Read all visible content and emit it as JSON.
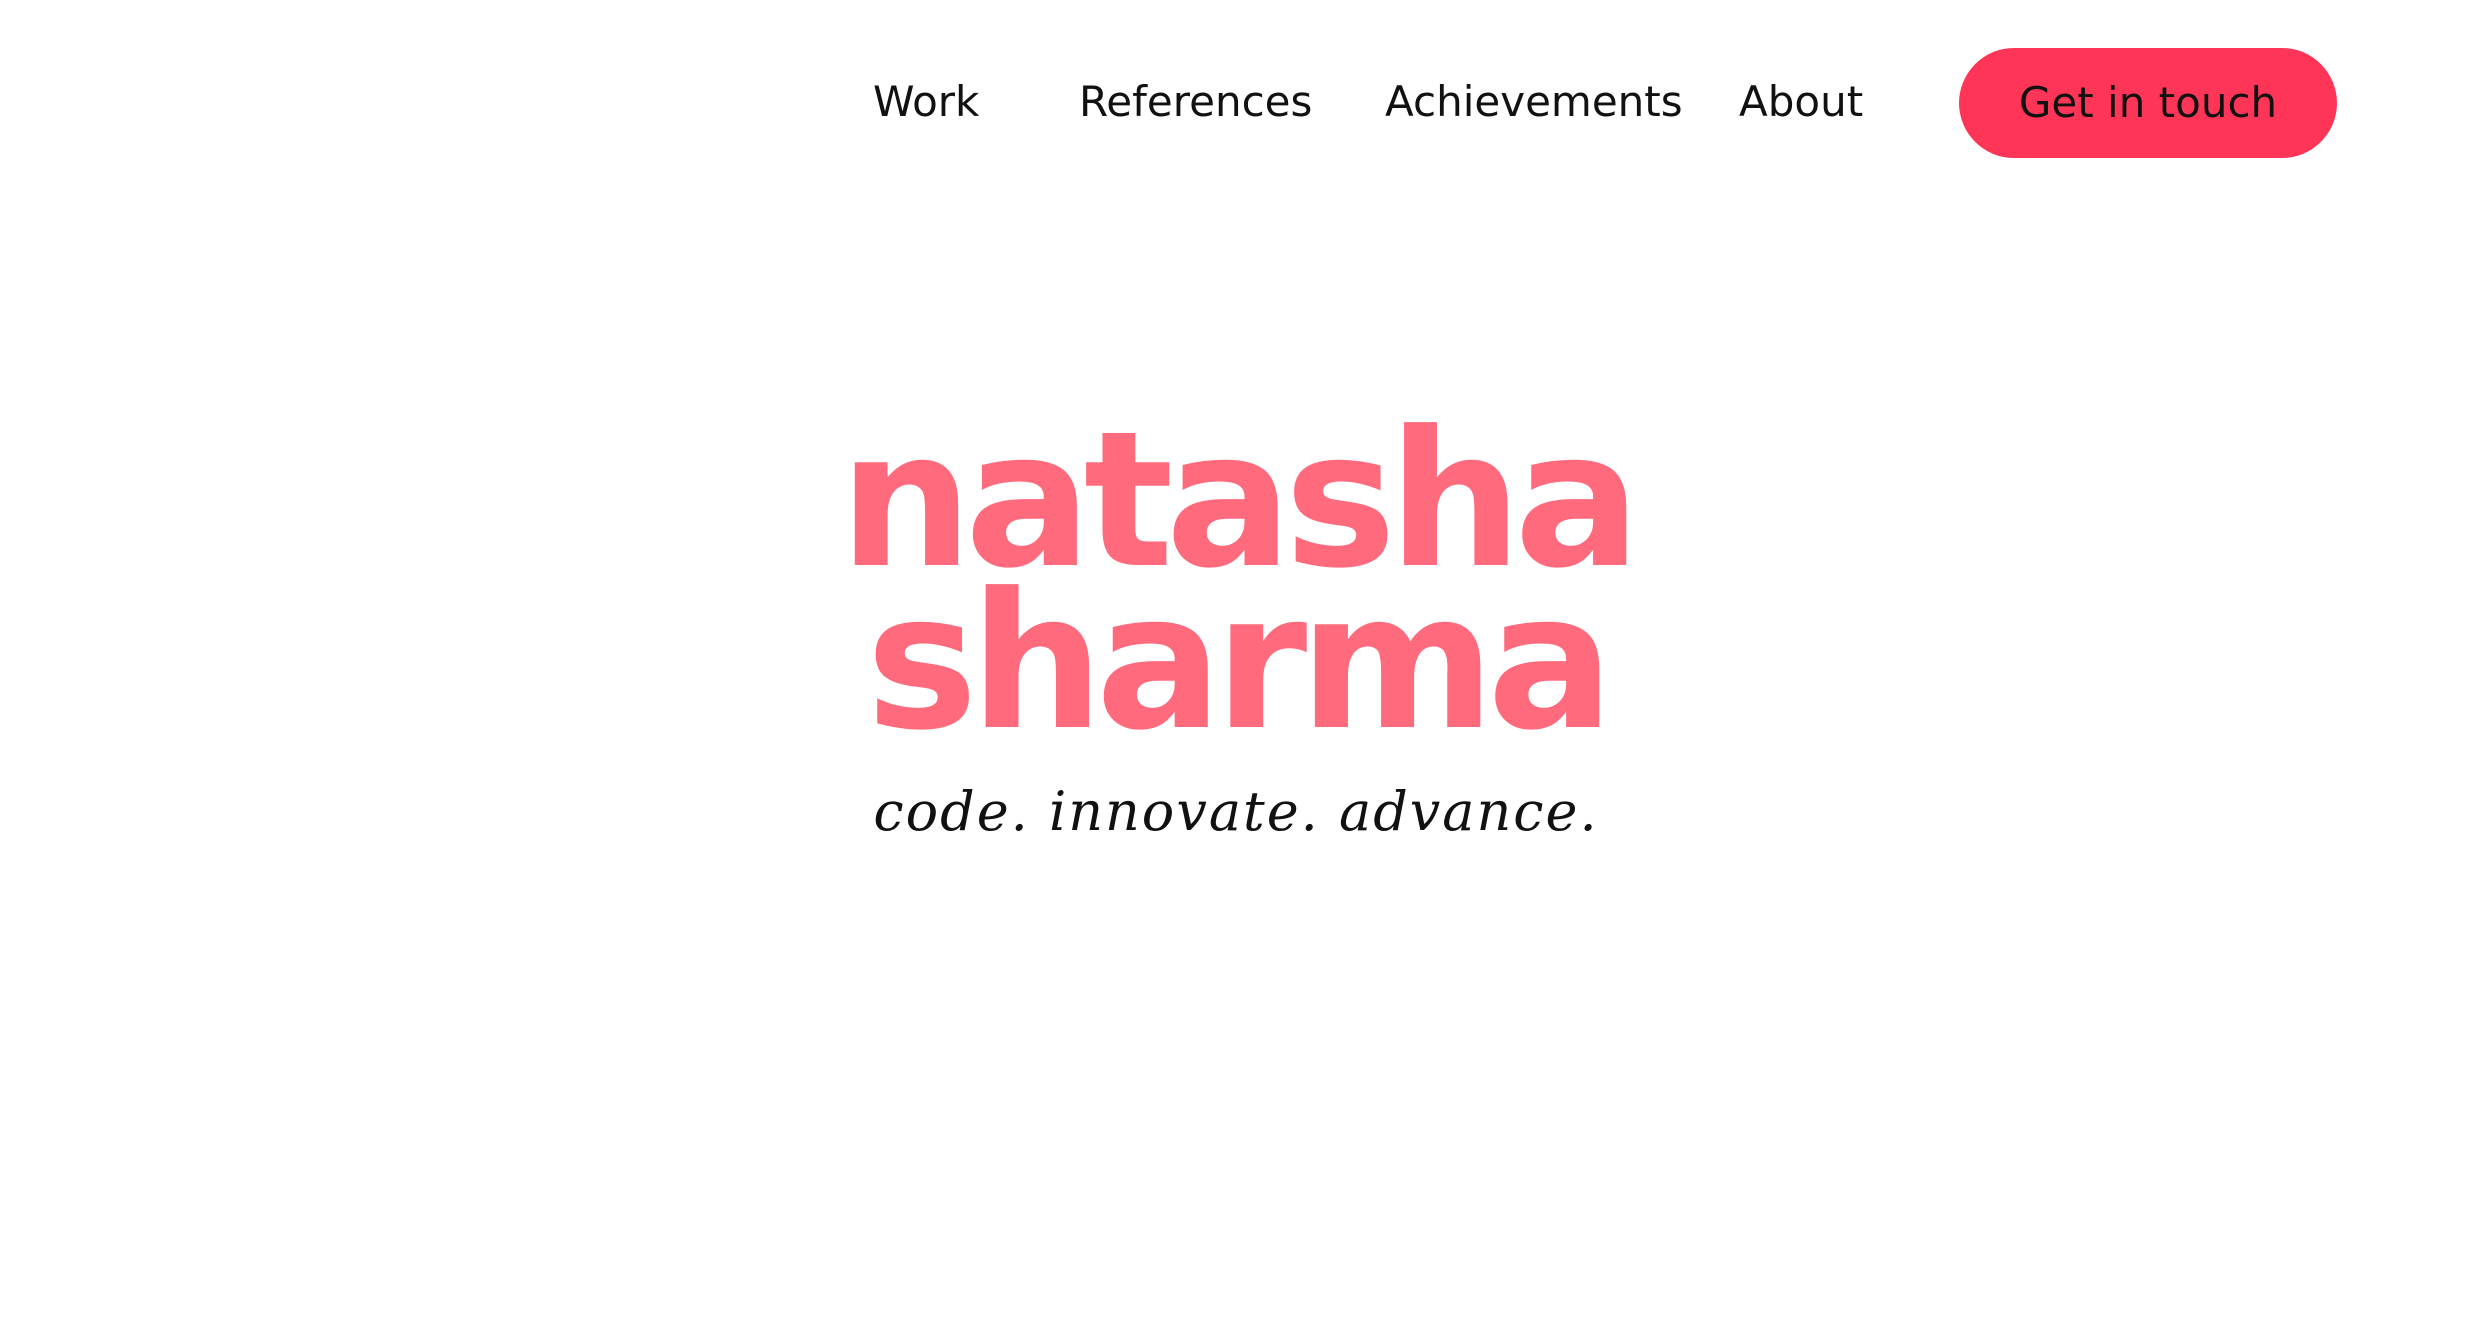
{
  "nav": {
    "items": [
      {
        "label": "Work"
      },
      {
        "label": "References"
      },
      {
        "label": "Achievements"
      },
      {
        "label": "About"
      }
    ],
    "cta_label": "Get in touch"
  },
  "hero": {
    "first_name": "natasha",
    "last_name": "sharma",
    "tagline": "code. innovate. advance."
  },
  "colors": {
    "accent_button": "#ff3558",
    "hero_name": "#ff6a7d",
    "text": "#111111",
    "background": "#ffffff"
  }
}
